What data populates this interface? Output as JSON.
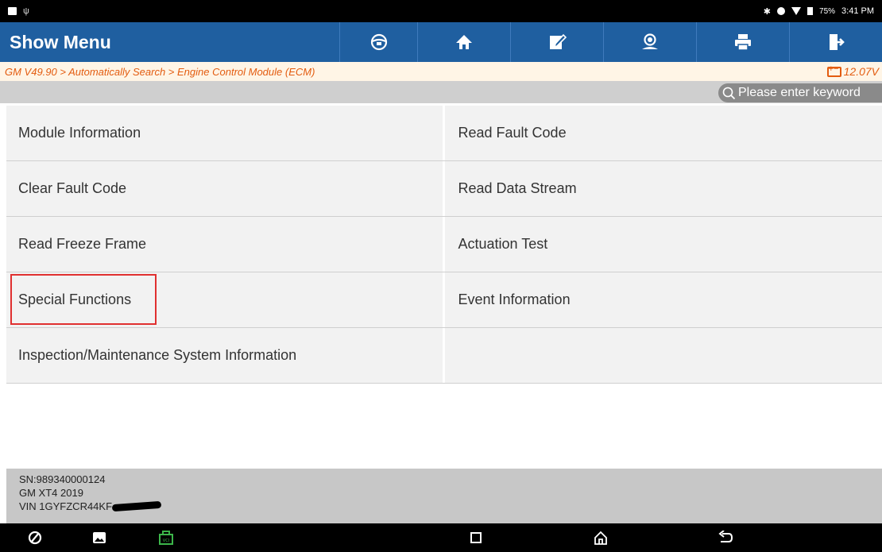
{
  "status_bar": {
    "battery_percent": "75%",
    "time": "3:41 PM"
  },
  "toolbar": {
    "title": "Show Menu",
    "buttons": [
      {
        "name": "steering-wheel-icon"
      },
      {
        "name": "home-icon"
      },
      {
        "name": "edit-icon"
      },
      {
        "name": "support-icon"
      },
      {
        "name": "print-icon"
      },
      {
        "name": "exit-icon"
      }
    ]
  },
  "breadcrumb": {
    "path": "GM V49.90 > Automatically Search > Engine Control Module (ECM)",
    "voltage": "12.07V"
  },
  "search": {
    "placeholder": "Please enter keyword"
  },
  "menu": {
    "items": [
      "Module Information",
      "Read Fault Code",
      "Clear Fault Code",
      "Read Data Stream",
      "Read Freeze Frame",
      "Actuation Test",
      "Special Functions",
      "Event Information",
      "Inspection/Maintenance System Information",
      ""
    ],
    "highlighted_index": 6,
    "highlight_color": "#e03030"
  },
  "footer": {
    "sn": "SN:989340000124",
    "vehicle": "GM XT4 2019",
    "vin": "VIN 1GYFZCR44KF"
  },
  "colors": {
    "toolbar": "#1f5fa0",
    "breadcrumb_text": "#e35c10",
    "vci_icon": "#3cb54a"
  }
}
